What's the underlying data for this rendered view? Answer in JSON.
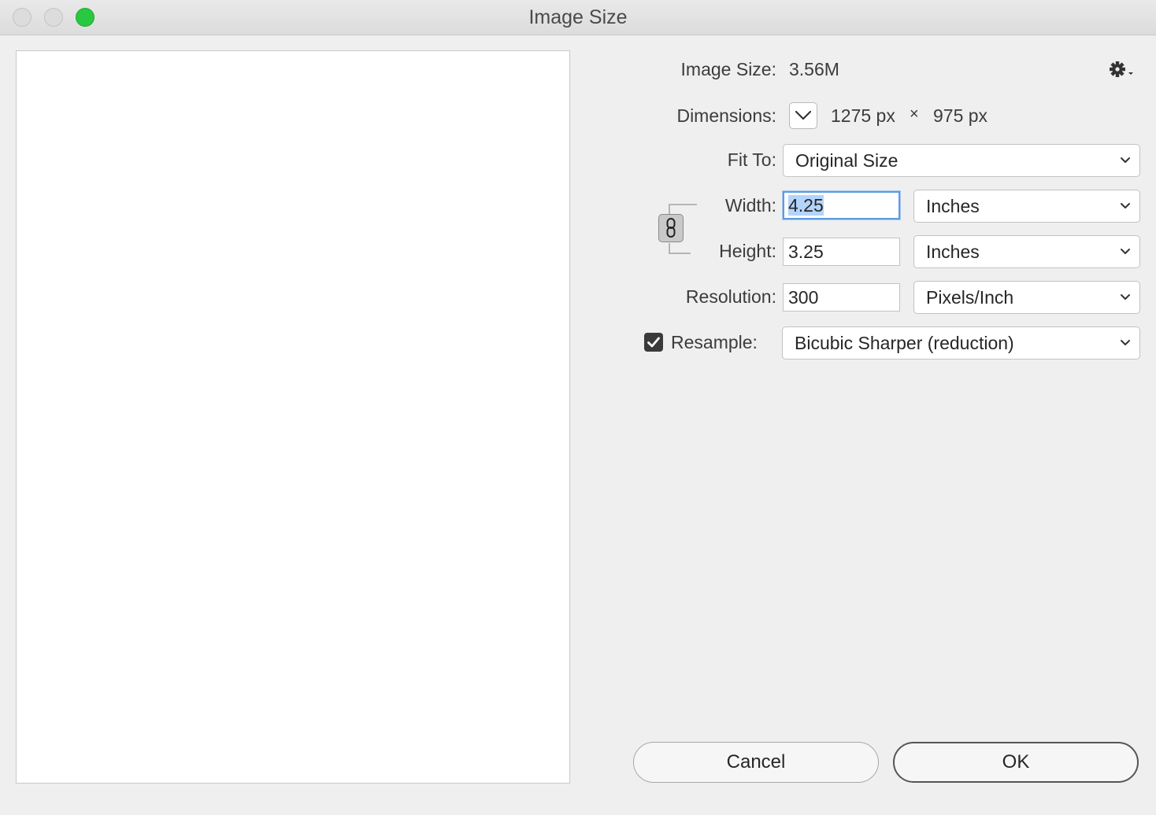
{
  "window": {
    "title": "Image Size"
  },
  "info": {
    "image_size_label": "Image Size:",
    "image_size_value": "3.56M",
    "dimensions_label": "Dimensions:",
    "width_px": "1275 px",
    "times_symbol": "×",
    "height_px": "975 px"
  },
  "fit_to": {
    "label": "Fit To:",
    "value": "Original Size"
  },
  "width": {
    "label": "Width:",
    "value": "4.25",
    "unit": "Inches"
  },
  "height": {
    "label": "Height:",
    "value": "3.25",
    "unit": "Inches"
  },
  "resolution": {
    "label": "Resolution:",
    "value": "300",
    "unit": "Pixels/Inch"
  },
  "resample": {
    "label": "Resample:",
    "checked": true,
    "method": "Bicubic Sharper (reduction)"
  },
  "buttons": {
    "cancel": "Cancel",
    "ok": "OK"
  },
  "icons": {
    "settings": "gear-icon",
    "dimensions_toggle": "chevron-down-icon",
    "constrain": "chain-link-icon",
    "select_arrow": "chevron-down-icon",
    "checkmark": "checkmark-icon"
  },
  "colors": {
    "zoom_button": "#28c840",
    "focus_ring": "#5d9be0",
    "selection": "#b3d4fc"
  }
}
